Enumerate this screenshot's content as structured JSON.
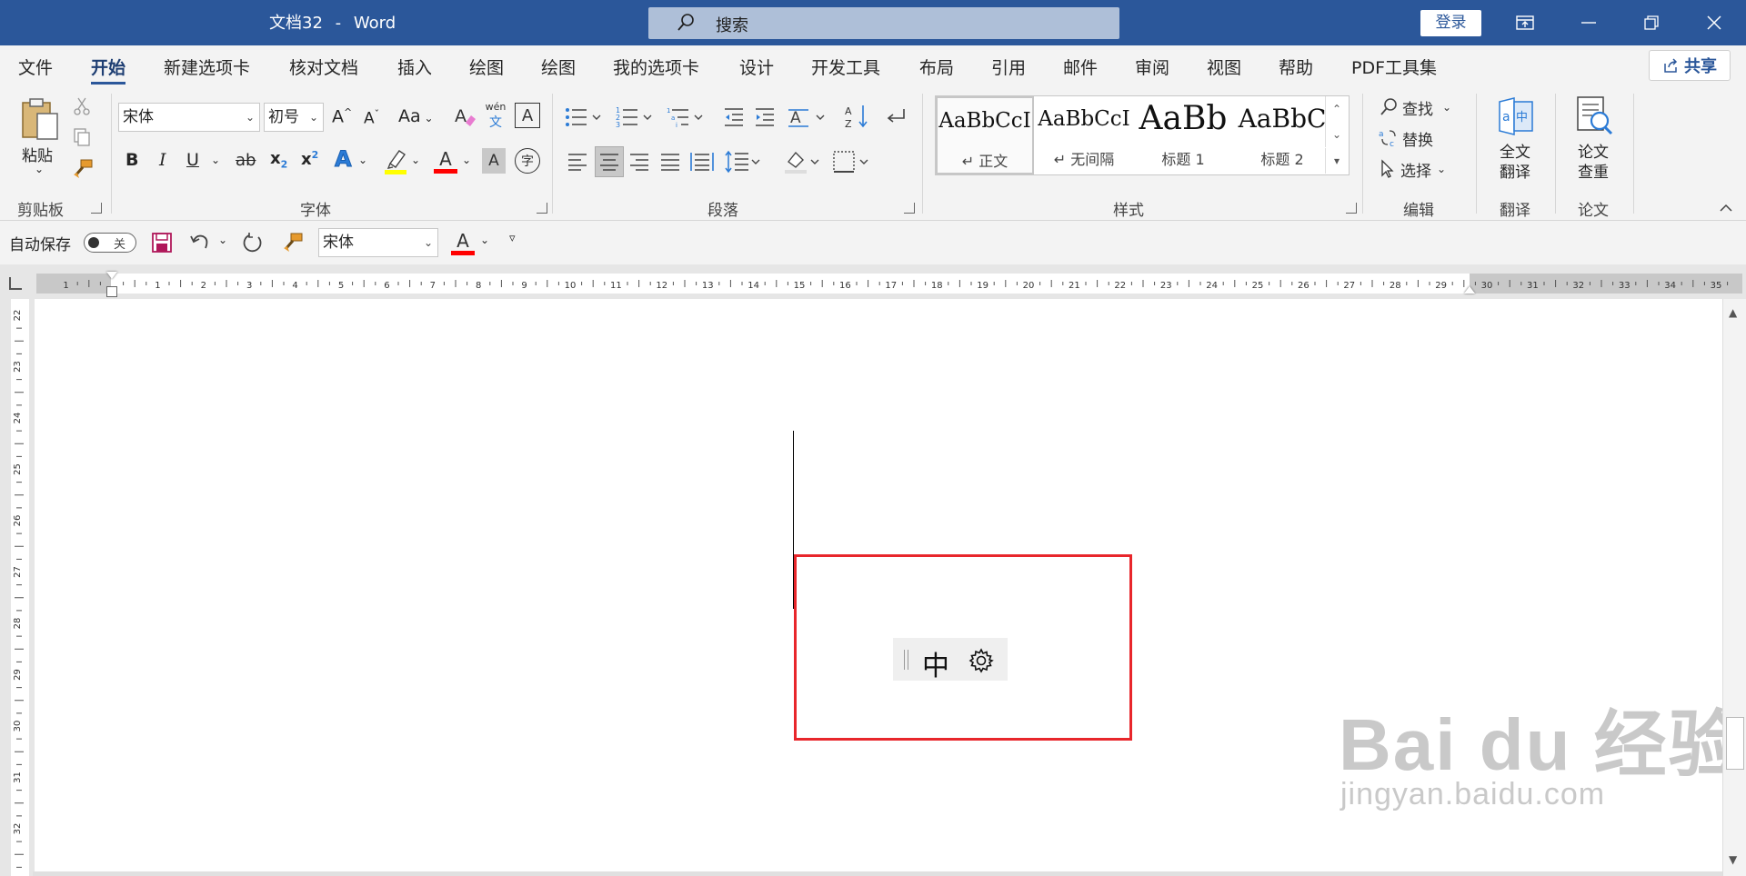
{
  "titlebar": {
    "doc_title": "文档32",
    "separator": "-",
    "app_name": "Word",
    "search_placeholder": "搜索",
    "login_label": "登录",
    "brand_color": "#2b579a"
  },
  "menu": {
    "tabs": [
      "文件",
      "开始",
      "新建选项卡",
      "核对文档",
      "插入",
      "绘图",
      "绘图",
      "我的选项卡",
      "设计",
      "开发工具",
      "布局",
      "引用",
      "邮件",
      "审阅",
      "视图",
      "帮助",
      "PDF工具集"
    ],
    "active_tab": "开始",
    "share_label": "共享"
  },
  "ribbon": {
    "clipboard": {
      "paste_label": "粘贴",
      "group_label": "剪贴板"
    },
    "font": {
      "font_name": "宋体",
      "font_size": "初号",
      "case_label": "Aa",
      "phonetic_top": "wén",
      "phonetic_bottom": "文",
      "bold": "B",
      "italic": "I",
      "underline": "U",
      "strike": "ab",
      "subscript": "x",
      "subscript_mark": "2",
      "superscript": "x",
      "superscript_mark": "2",
      "text_effect": "A",
      "font_color_letter": "A",
      "char_shading": "A",
      "enclose_char": "字",
      "group_label": "字体"
    },
    "paragraph": {
      "group_label": "段落"
    },
    "styles": {
      "items": [
        {
          "sample": "AaBbCcI",
          "name": "↵ 正文"
        },
        {
          "sample": "AaBbCcI",
          "name": "↵ 无间隔"
        },
        {
          "sample": "AaBb",
          "name": "标题 1"
        },
        {
          "sample": "AaBbC",
          "name": "标题 2"
        }
      ],
      "group_label": "样式"
    },
    "editing": {
      "find": "查找",
      "replace": "替换",
      "select": "选择",
      "group_label": "编辑"
    },
    "translate": {
      "label_line1": "全文",
      "label_line2": "翻译",
      "group_label": "翻译"
    },
    "paper": {
      "label_line1": "论文",
      "label_line2": "查重",
      "group_label": "论文"
    }
  },
  "qat": {
    "autosave_label": "自动保存",
    "autosave_state": "关",
    "font_name": "宋体",
    "font_color_letter": "A"
  },
  "ruler": {
    "h_labels": [
      "1",
      "1",
      "2",
      "3",
      "4",
      "5",
      "6",
      "7",
      "8",
      "9",
      "10",
      "11",
      "12",
      "13",
      "14",
      "15",
      "16",
      "17",
      "18",
      "19",
      "20",
      "21",
      "22",
      "23",
      "24",
      "25",
      "26",
      "27",
      "28",
      "29",
      "30",
      "31",
      "32",
      "33",
      "34",
      "35"
    ],
    "v_labels": [
      "22",
      "23",
      "24",
      "25",
      "26",
      "27",
      "28",
      "29",
      "30",
      "31",
      "32"
    ]
  },
  "ime": {
    "mode": "中"
  },
  "watermark": {
    "line1": "Bai du 经验",
    "line2": "jingyan.baidu.com"
  },
  "colors": {
    "accent_red": "#e8262b",
    "highlight_yellow": "#ffff00",
    "font_red": "#ff0000"
  }
}
